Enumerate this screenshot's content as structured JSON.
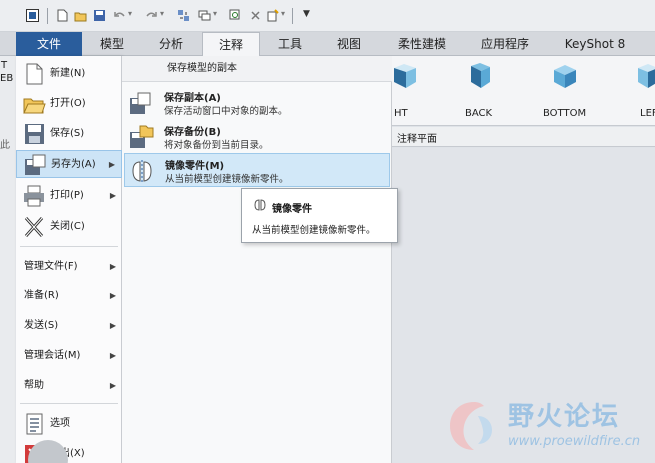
{
  "tabs": [
    "文件",
    "模型",
    "分析",
    "注释",
    "工具",
    "视图",
    "柔性建模",
    "应用程序",
    "KeyShot 8"
  ],
  "active_tab": "注释",
  "views": [
    "HT",
    "BACK",
    "BOTTOM",
    "LEF"
  ],
  "left_strip": [
    "T",
    "EB",
    "此"
  ],
  "gbar_label": "注释平面",
  "file_menu": {
    "items": [
      {
        "label": "新建(N)",
        "icon": "new-file-icon"
      },
      {
        "label": "打开(O)",
        "icon": "open-folder-icon"
      },
      {
        "label": "保存(S)",
        "icon": "save-icon"
      },
      {
        "label": "另存为(A)",
        "icon": "save-as-icon",
        "selected": true
      },
      {
        "label": "打印(P)",
        "icon": "print-icon"
      },
      {
        "label": "关闭(C)",
        "icon": "close-icon"
      }
    ],
    "sub_items": [
      "管理文件(F)",
      "准备(R)",
      "发送(S)",
      "管理会话(M)",
      "帮助"
    ],
    "bottom_items": [
      {
        "label": "选项",
        "icon": "options-icon"
      },
      {
        "label": "退出(X)",
        "icon": "exit-icon"
      }
    ]
  },
  "save_as_panel": {
    "header": "保存模型的副本",
    "items": [
      {
        "title": "保存副本(A)",
        "desc": "保存活动窗口中对象的副本。",
        "icon": "save-copy-icon"
      },
      {
        "title": "保存备份(B)",
        "desc": "将对象备份到当前目录。",
        "icon": "save-backup-icon"
      },
      {
        "title": "镜像零件(M)",
        "desc": "从当前模型创建镜像新零件。",
        "icon": "mirror-part-icon",
        "selected": true
      }
    ]
  },
  "tooltip": {
    "title": "镜像零件",
    "desc": "从当前模型创建镜像新零件。",
    "icon": "mirror-part-icon"
  },
  "watermark": {
    "text": "野火论坛",
    "url": "www.proewildfire.cn"
  }
}
